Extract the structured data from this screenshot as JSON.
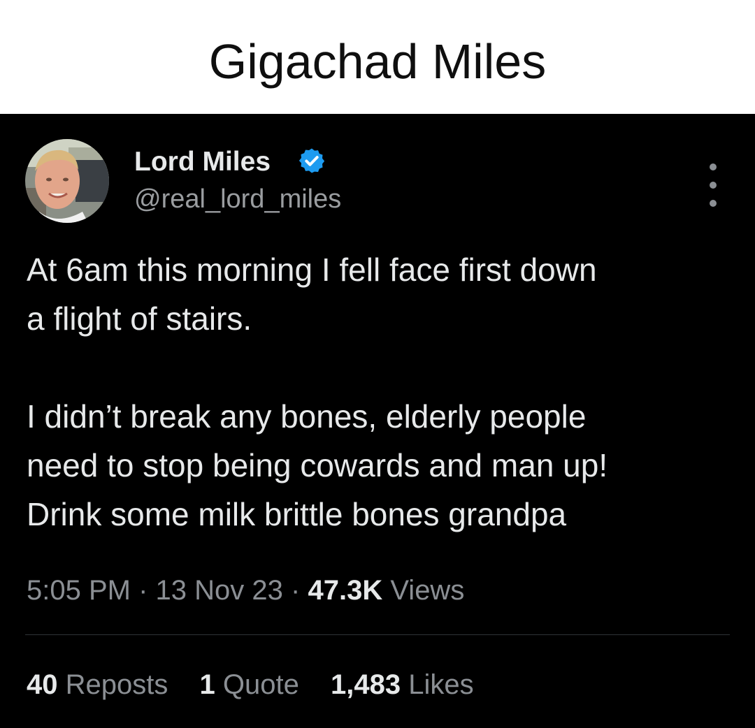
{
  "caption": "Gigachad Miles",
  "tweet": {
    "display_name": "Lord Miles",
    "handle": "@real_lord_miles",
    "verified": true,
    "verified_color": "#1d9bf0",
    "more_icon": "more-vertical-icon",
    "body_lines_1": [
      "At 6am this morning I fell face first down",
      "a flight of stairs."
    ],
    "body_lines_2": [
      "I didn’t break any bones, elderly people",
      "need to stop being cowards and man up!",
      "Drink some milk brittle bones grandpa"
    ],
    "time": "5:05 PM",
    "separator": "·",
    "date": "13 Nov 23",
    "views_count": "47.3K",
    "views_label": "Views"
  },
  "stats": {
    "reposts_count": "40",
    "reposts_label": "Reposts",
    "quotes_count": "1",
    "quotes_label": "Quote",
    "likes_count": "1,483",
    "likes_label": "Likes"
  }
}
